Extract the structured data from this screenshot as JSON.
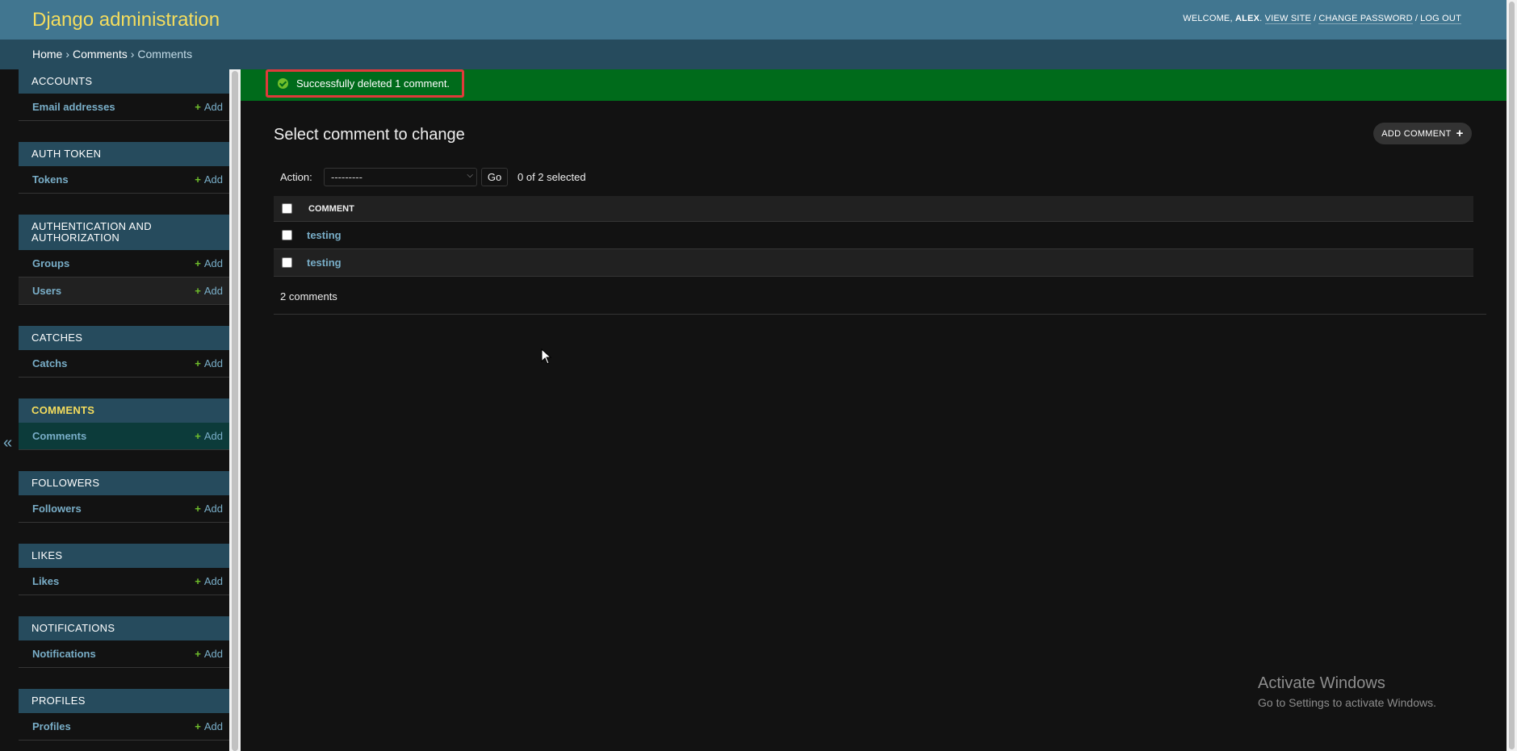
{
  "header": {
    "brand": "Django administration",
    "welcome": "Welcome,",
    "username": "alex",
    "view_site": "View site",
    "change_password": "Change password",
    "log_out": "Log out",
    "sep": "/"
  },
  "breadcrumbs": {
    "home": "Home",
    "app": "Comments",
    "model": "Comments",
    "sep": "›"
  },
  "nav_toggle": "«",
  "sidebar": {
    "add_label": "Add",
    "modules": [
      {
        "caption": "Accounts",
        "models": [
          "Email addresses"
        ]
      },
      {
        "caption": "Auth Token",
        "models": [
          "Tokens"
        ]
      },
      {
        "caption": "Authentication and Authorization",
        "models": [
          "Groups",
          "Users"
        ]
      },
      {
        "caption": "Catches",
        "models": [
          "Catchs"
        ]
      },
      {
        "caption": "Comments",
        "models": [
          "Comments"
        ],
        "current": true
      },
      {
        "caption": "Followers",
        "models": [
          "Followers"
        ]
      },
      {
        "caption": "Likes",
        "models": [
          "Likes"
        ]
      },
      {
        "caption": "Notifications",
        "models": [
          "Notifications"
        ]
      },
      {
        "caption": "Profiles",
        "models": [
          "Profiles"
        ]
      }
    ]
  },
  "message": {
    "text": "Successfully deleted 1 comment."
  },
  "page": {
    "title": "Select comment to change",
    "add_button": "Add comment"
  },
  "actions": {
    "label": "Action:",
    "selected_value": "---------",
    "go": "Go",
    "counter": "0 of 2 selected"
  },
  "table": {
    "column": "Comment",
    "rows": [
      "testing",
      "testing"
    ]
  },
  "paginator": {
    "count": "2 comments"
  },
  "watermark": {
    "line1": "Activate Windows",
    "line2": "Go to Settings to activate Windows."
  },
  "colors": {
    "header_bg": "#417690",
    "brand": "#f5dd5d",
    "breadcrumb_bg": "#264b5d",
    "success_bg": "#006b1b",
    "link": "#79aec8",
    "add_green": "#70bf2b",
    "highlight_border": "#e03a3a"
  }
}
